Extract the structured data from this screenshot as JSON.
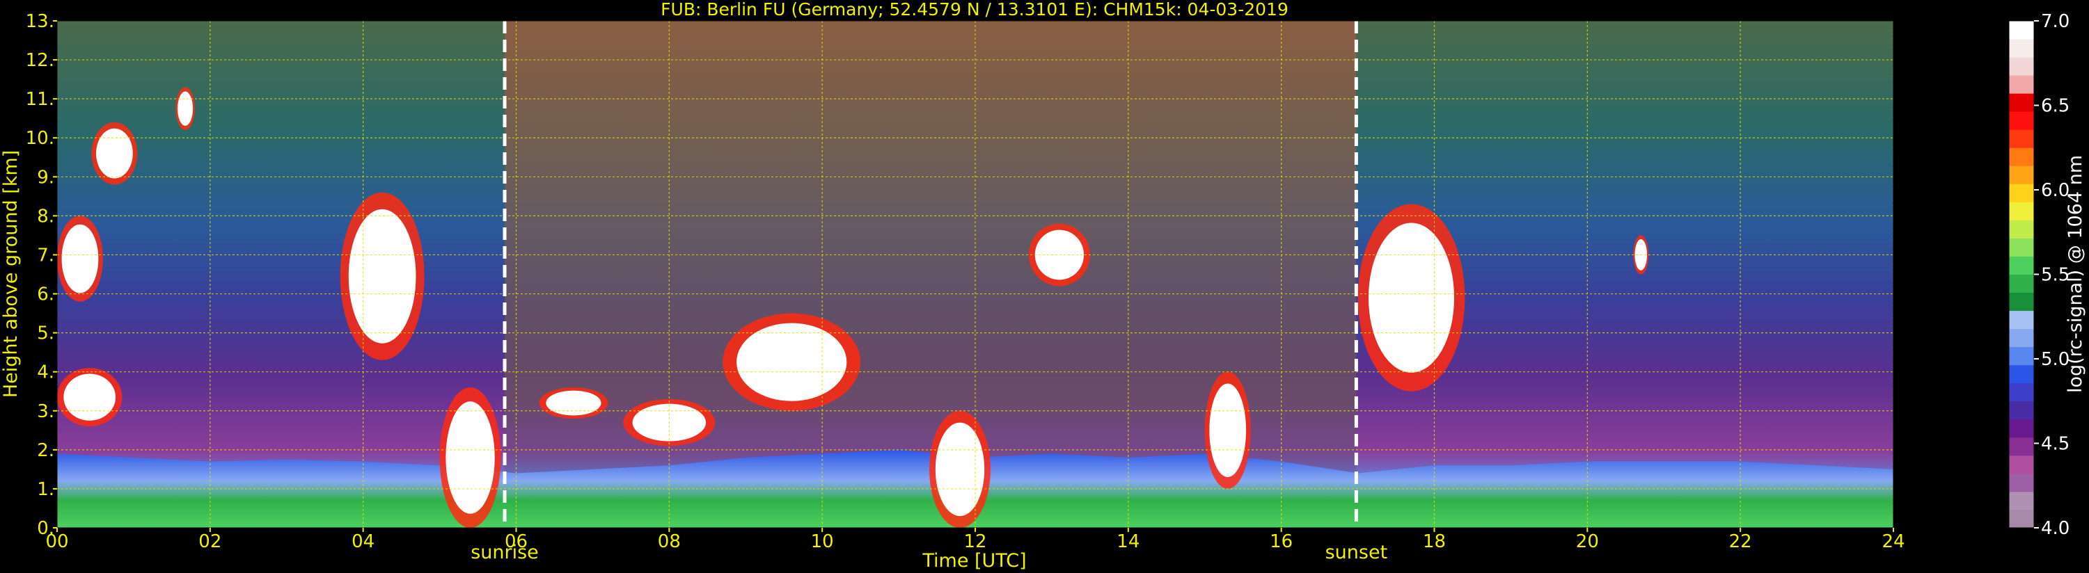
{
  "title": "FUB: Berlin FU (Germany; 52.4579 N / 13.3101 E):    CHM15k: 04-03-2019",
  "chart_data": {
    "type": "heatmap",
    "title": "FUB: Berlin FU (Germany; 52.4579 N / 13.3101 E):    CHM15k: 04-03-2019",
    "xlabel": "Time [UTC]",
    "ylabel": "Height above ground [km]",
    "xlim": [
      0,
      24
    ],
    "ylim": [
      0,
      13
    ],
    "x_ticks": [
      "00",
      "02",
      "04",
      "06",
      "08",
      "10",
      "12",
      "14",
      "16",
      "18",
      "20",
      "22",
      "24"
    ],
    "y_ticks": [
      "0.",
      "1.",
      "2.",
      "3.",
      "4.",
      "5.",
      "6.",
      "7.",
      "8.",
      "9.",
      "10.",
      "11.",
      "12.",
      "13."
    ],
    "grid": true,
    "events": [
      {
        "label": "sunrise",
        "time": 5.85
      },
      {
        "label": "sunset",
        "time": 16.98
      }
    ],
    "colorbar": {
      "label": "log(rc-signal) @ 1064 nm",
      "range": [
        4.0,
        7.0
      ],
      "ticks": [
        "4.0",
        "4.5",
        "5.0",
        "5.5",
        "6.0",
        "6.5",
        "7.0"
      ],
      "colors": [
        "#a78aa8",
        "#b091b3",
        "#9d5fa5",
        "#b04fa0",
        "#882f95",
        "#6a1a8f",
        "#4a2ca4",
        "#3d3ec9",
        "#2b55e6",
        "#5a86f0",
        "#88a9f2",
        "#a9c2f4",
        "#1a8f3a",
        "#2fb04a",
        "#4dd060",
        "#8ce25a",
        "#c2ec4a",
        "#f0f03a",
        "#ffd21a",
        "#ffa514",
        "#ff7a12",
        "#ff3a10",
        "#ff1010",
        "#e40000",
        "#f0a8a8",
        "#f3d6d6",
        "#f6ecec",
        "#ffffff"
      ]
    },
    "cloud_layers": [
      {
        "t0": 0.0,
        "t1": 0.6,
        "h0": 5.8,
        "h1": 8.0
      },
      {
        "t0": 0.45,
        "t1": 1.05,
        "h0": 8.8,
        "h1": 10.4
      },
      {
        "t0": 1.55,
        "t1": 1.8,
        "h0": 10.2,
        "h1": 11.3
      },
      {
        "t0": 0.0,
        "t1": 0.85,
        "h0": 2.6,
        "h1": 4.1
      },
      {
        "t0": 3.7,
        "t1": 4.8,
        "h0": 4.3,
        "h1": 8.6
      },
      {
        "t0": 5.0,
        "t1": 5.8,
        "h0": 0.0,
        "h1": 3.6
      },
      {
        "t0": 6.3,
        "t1": 7.2,
        "h0": 2.8,
        "h1": 3.6
      },
      {
        "t0": 7.4,
        "t1": 8.6,
        "h0": 2.1,
        "h1": 3.3
      },
      {
        "t0": 8.7,
        "t1": 10.5,
        "h0": 3.0,
        "h1": 5.5
      },
      {
        "t0": 12.7,
        "t1": 13.5,
        "h0": 6.2,
        "h1": 7.8
      },
      {
        "t0": 11.4,
        "t1": 12.2,
        "h0": 0.0,
        "h1": 3.0
      },
      {
        "t0": 15.0,
        "t1": 15.6,
        "h0": 1.0,
        "h1": 4.0
      },
      {
        "t0": 17.0,
        "t1": 18.4,
        "h0": 3.5,
        "h1": 8.3
      },
      {
        "t0": 20.6,
        "t1": 20.8,
        "h0": 6.5,
        "h1": 7.5
      }
    ],
    "boundary_layer_top": [
      [
        0,
        1.9
      ],
      [
        1,
        1.8
      ],
      [
        2,
        1.7
      ],
      [
        3,
        1.75
      ],
      [
        4,
        1.7
      ],
      [
        5,
        1.6
      ],
      [
        6,
        1.4
      ],
      [
        7,
        1.5
      ],
      [
        8,
        1.6
      ],
      [
        9,
        1.8
      ],
      [
        10,
        1.9
      ],
      [
        11,
        2.0
      ],
      [
        12,
        1.8
      ],
      [
        13,
        1.9
      ],
      [
        14,
        1.8
      ],
      [
        15,
        1.9
      ],
      [
        16,
        1.7
      ],
      [
        17,
        1.4
      ],
      [
        18,
        1.6
      ],
      [
        19,
        1.6
      ],
      [
        20,
        1.7
      ],
      [
        21,
        1.7
      ],
      [
        22,
        1.7
      ],
      [
        23,
        1.6
      ],
      [
        24,
        1.5
      ]
    ]
  }
}
